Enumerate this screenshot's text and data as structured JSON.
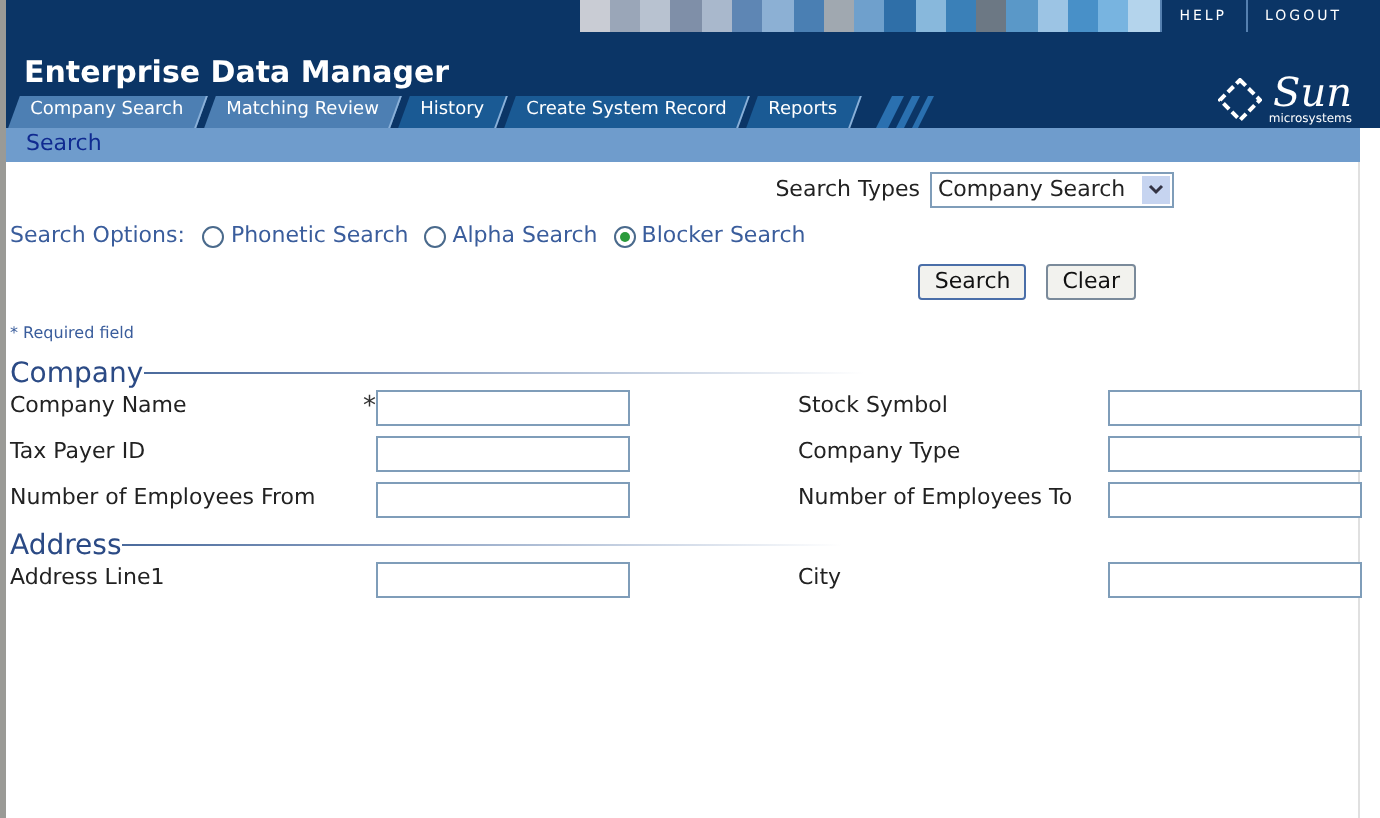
{
  "header": {
    "links": [
      "HELP",
      "LOGOUT"
    ],
    "title": "Enterprise Data Manager",
    "logo": {
      "name": "Sun",
      "tagline": "microsystems"
    }
  },
  "tabs": [
    {
      "label": "Company Search",
      "selected": true
    },
    {
      "label": "Matching Review",
      "selected": true
    },
    {
      "label": "History",
      "selected": false
    },
    {
      "label": "Create System Record",
      "selected": false
    },
    {
      "label": "Reports",
      "selected": false
    }
  ],
  "page_title": "Search",
  "search_types": {
    "label": "Search Types",
    "value": "Company Search"
  },
  "search_options": {
    "label": "Search Options:",
    "options": [
      {
        "label": "Phonetic Search",
        "selected": false
      },
      {
        "label": "Alpha Search",
        "selected": false
      },
      {
        "label": "Blocker Search",
        "selected": true
      }
    ]
  },
  "buttons": [
    "Search",
    "Clear"
  ],
  "required_note": "* Required field",
  "sections": [
    {
      "title": "Company",
      "rows": [
        [
          {
            "label": "Company Name",
            "required_mark": "*"
          },
          {
            "label": "Stock Symbol"
          }
        ],
        [
          {
            "label": "Tax Payer ID"
          },
          {
            "label": "Company Type"
          }
        ],
        [
          {
            "label": "Number of Employees From"
          },
          {
            "label": "Number of Employees To"
          }
        ]
      ]
    },
    {
      "title": "Address",
      "rows": [
        [
          {
            "label": "Address Line1"
          },
          {
            "label": "City"
          }
        ]
      ]
    }
  ]
}
